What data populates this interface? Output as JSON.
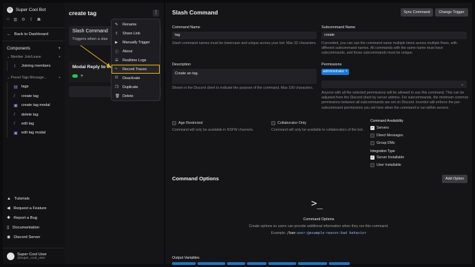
{
  "app": {
    "name": "Super Cool Bot"
  },
  "sidebar": {
    "back_label": "Back to Dashboard",
    "components_label": "Components",
    "groups": [
      {
        "label": "Member Join/Leave",
        "items": [
          {
            "label": "Joining members",
            "icon": "wave-icon"
          }
        ]
      },
      {
        "label": "Preset Tags Message...",
        "items": [
          {
            "label": "tags",
            "icon": "doc-icon"
          },
          {
            "label": "create tag",
            "icon": "slash-icon"
          },
          {
            "label": "create tag modal",
            "icon": "modal-icon"
          },
          {
            "label": "delete tag",
            "icon": "slash-icon"
          },
          {
            "label": "edit tag",
            "icon": "slash-icon"
          },
          {
            "label": "edit tag modal",
            "icon": "modal-icon"
          }
        ]
      }
    ],
    "bottom_links": [
      {
        "label": "Tutorials",
        "icon": "graduation-icon"
      },
      {
        "label": "Request a Feature",
        "icon": "megaphone-icon"
      },
      {
        "label": "Report a Bug",
        "icon": "bug-icon"
      },
      {
        "label": "Documentation",
        "icon": "book-icon"
      },
      {
        "label": "Discord Server",
        "icon": "discord-icon"
      }
    ],
    "user": {
      "name": "Super Cool User",
      "handle": "@super_cool_user"
    }
  },
  "middle": {
    "title": "create tag",
    "card1": {
      "title": "Slash Command",
      "subtitle": "Triggers when a slas"
    },
    "card2": {
      "title": "Modal Reply to in"
    },
    "add_label": "+ A"
  },
  "menu": {
    "items": [
      {
        "label": "Rename",
        "icon": "pencil-icon"
      },
      {
        "label": "Share Link",
        "icon": "share-icon"
      },
      {
        "label": "Manually Trigger",
        "icon": "play-icon"
      },
      {
        "label": "About",
        "icon": "info-icon"
      },
      {
        "label": "Realtime Logs",
        "icon": "logs-icon"
      },
      {
        "label": "Record Traces",
        "icon": "traces-icon"
      },
      {
        "label": "Deactivate",
        "icon": "power-icon"
      },
      {
        "label": "Duplicate",
        "icon": "copy-icon"
      },
      {
        "label": "Delete",
        "icon": "trash-icon"
      }
    ],
    "highlighted": "Record Traces",
    "highlight_color": "#e0b32b"
  },
  "main": {
    "title": "Slash Command",
    "sync_label": "Sync Command",
    "change_trigger_label": "Change Trigger",
    "command_name": {
      "label": "Command Name",
      "value": "tag",
      "hint": "Slash command names must be lowercase and unique across your bot. Max 32 characters."
    },
    "subcommand_name": {
      "label": "Subcommand Name",
      "value": "create",
      "hint": "If provided, you can use the command name multiple times across multiple flows, with different subcommand names. All commands with the same name must have subcommands, and those subcommands must be unique."
    },
    "description": {
      "label": "Description",
      "value": "Create an tag.",
      "hint": "Shown in the Discord client to indicate the purpose of the command. Max 100 characters."
    },
    "permissions": {
      "label": "Permissions",
      "tag": "administrator ×",
      "hint": "Anyone with all the selected permissions will be allowed to use this command. This can be adjusted from the Discord client by server admins. For subcommands, the minimum common permissions between all subcommands are set on Discord. Inventor will enforce the per-subcommand permissions you set here when the command is run within servers."
    },
    "age_restricted": {
      "label": "Age Restricted",
      "hint": "Command will only be available in NSFW channels."
    },
    "collaborator_only": {
      "label": "Collaborator Only",
      "hint": "Command will only be available to collaborators of the bot."
    },
    "availability": {
      "label": "Command Availability",
      "options": [
        {
          "label": "Servers",
          "checked": true
        },
        {
          "label": "Direct Messages",
          "checked": false
        },
        {
          "label": "Group DMs",
          "checked": false
        }
      ]
    },
    "integration": {
      "label": "Integration Type",
      "options": [
        {
          "label": "Server Installable",
          "checked": true
        },
        {
          "label": "User Installable",
          "checked": false
        }
      ]
    },
    "options_section": {
      "title": "Command Options",
      "add_label": "Add Option",
      "empty_title": "Command Options",
      "empty_hint": "Create options so users can provide additional information when they run this command.",
      "example_prefix": "Example: ",
      "example_cmd": "/ban",
      "example_user": "user:@example",
      "example_reason": "reason:bad behavior"
    },
    "output_label": "Output Variables",
    "accent": "#1877d2"
  }
}
